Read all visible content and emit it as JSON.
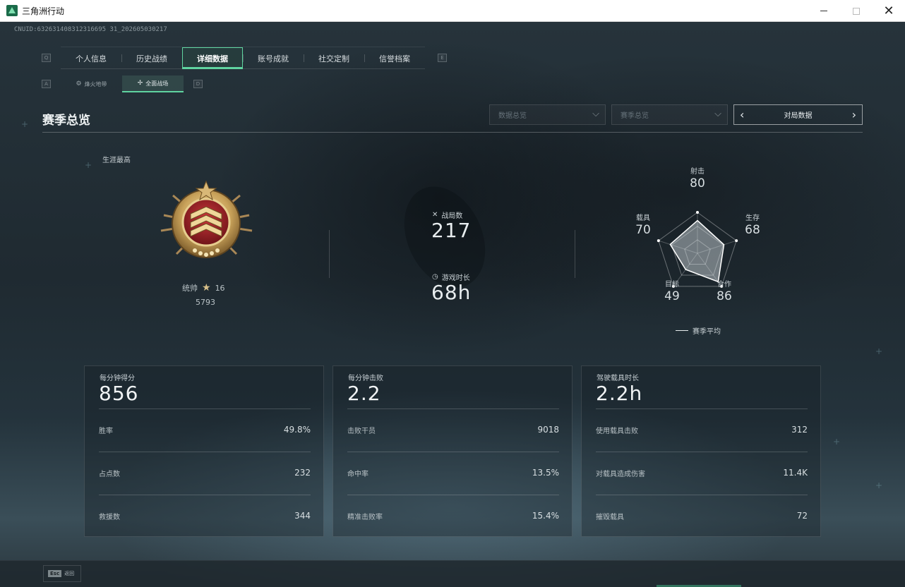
{
  "window": {
    "title": "三角洲行动",
    "minimize": "",
    "maximize": "",
    "close": "✕"
  },
  "uid": "CNUID:632631408312316695 31_202605030217",
  "main_tabs": [
    {
      "label": "个人信息"
    },
    {
      "label": "历史战绩"
    },
    {
      "label": "详细数据"
    },
    {
      "label": "账号成就"
    },
    {
      "label": "社交定制"
    },
    {
      "label": "信誉档案"
    }
  ],
  "key_hints": {
    "left": "Q",
    "right": "E",
    "sub_left": "A",
    "sub_right": "D"
  },
  "sub_tabs": [
    {
      "label": "烽火地带",
      "icon": "fire-zone-icon"
    },
    {
      "label": "全面战场",
      "icon": "battlefield-icon"
    }
  ],
  "section_title": "赛季总览",
  "filters": {
    "dropdown1": "数据总览",
    "dropdown2": "赛季总览",
    "pager_label": "对局数据"
  },
  "career": {
    "label": "生涯最高",
    "rank_name": "统帅",
    "rank_stars": "16",
    "score": "5793"
  },
  "middle": {
    "matches_label": "战局数",
    "matches_value": "217",
    "playtime_label": "游戏时长",
    "playtime_value": "68h"
  },
  "radar": {
    "legend": "赛季平均",
    "axes": [
      {
        "label": "射击",
        "value": "80",
        "score": 80
      },
      {
        "label": "生存",
        "value": "68",
        "score": 68
      },
      {
        "label": "合作",
        "value": "86",
        "score": 86
      },
      {
        "label": "目标",
        "value": "49",
        "score": 49
      },
      {
        "label": "载具",
        "value": "70",
        "score": 70
      }
    ]
  },
  "cards": [
    {
      "title": "每分钟得分",
      "big": "856",
      "rows": [
        {
          "k": "胜率",
          "v": "49.8%"
        },
        {
          "k": "占点数",
          "v": "232"
        },
        {
          "k": "救援数",
          "v": "344"
        }
      ]
    },
    {
      "title": "每分钟击败",
      "big": "2.2",
      "rows": [
        {
          "k": "击败干员",
          "v": "9018"
        },
        {
          "k": "命中率",
          "v": "13.5%"
        },
        {
          "k": "精准击败率",
          "v": "15.4%"
        }
      ]
    },
    {
      "title": "驾驶载具时长",
      "big": "2.2h",
      "rows": [
        {
          "k": "使用载具击败",
          "v": "312"
        },
        {
          "k": "对载具造成伤害",
          "v": "11.4K"
        },
        {
          "k": "摧毁载具",
          "v": "72"
        }
      ]
    }
  ],
  "bottom": {
    "esc_key": "Esc",
    "esc_label": "返回"
  }
}
